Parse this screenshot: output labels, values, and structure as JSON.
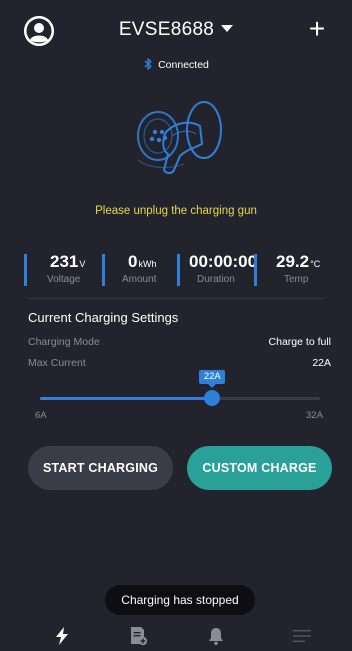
{
  "header": {
    "device_name": "EVSE8688",
    "add_label": "+",
    "connection_status": "Connected"
  },
  "status_message": "Please unplug the charging gun",
  "stats": [
    {
      "value": "231",
      "unit": "V",
      "label": "Voltage"
    },
    {
      "value": "0",
      "unit": "kWh",
      "label": "Amount"
    },
    {
      "value": "00:00:00",
      "unit": "",
      "label": "Duration"
    },
    {
      "value": "29.2",
      "unit": "°C",
      "label": "Temp"
    }
  ],
  "settings": {
    "title": "Current Charging Settings",
    "mode_label": "Charging Mode",
    "mode_value": "Charge to full",
    "max_current_label": "Max Current",
    "max_current_value": "22A",
    "slider": {
      "min_label": "6A",
      "max_label": "32A",
      "min": 6,
      "max": 32,
      "value": 22,
      "tooltip": "22A"
    }
  },
  "buttons": {
    "start": "START CHARGING",
    "custom": "CUSTOM CHARGE"
  },
  "toast": "Charging has stopped",
  "colors": {
    "background": "#22232d",
    "accent_blue": "#2f80d8",
    "accent_teal": "#2aa198",
    "warning": "#e7d84a",
    "muted_text": "#8a8b94"
  },
  "nav": [
    {
      "icon": "lightning-icon",
      "active": true
    },
    {
      "icon": "document-add-icon",
      "active": false
    },
    {
      "icon": "bell-icon",
      "active": false
    },
    {
      "icon": "menu-icon",
      "active": false
    }
  ]
}
